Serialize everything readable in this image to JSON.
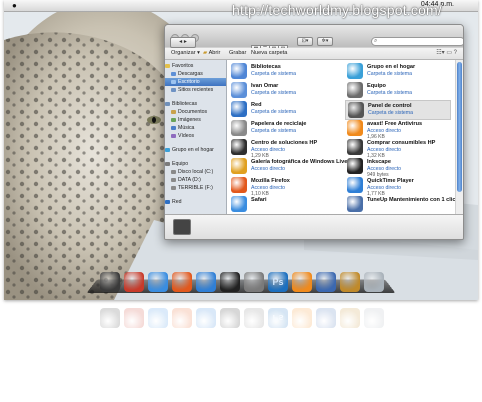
{
  "watermark": "http://techworldmy.blogspot.com/",
  "menubar": {
    "clock": "04:44 p.m."
  },
  "window": {
    "nav_label": "◂ ▸",
    "toolbar_view_buttons": [
      "▦",
      "☰",
      "▥",
      "▤"
    ],
    "toolbar_action_label": "✲▾",
    "toolbar_share_label": "⊡▾",
    "search_placeholder": "",
    "command_bar": {
      "organize": "Organizar ▾",
      "open": "Abrir",
      "burn": "Grabar",
      "new_folder": "Nueva carpeta",
      "view_icons": "☷▾ ▭ ?"
    },
    "sidebar": {
      "favorites_header": "Favoritos",
      "favorites": [
        "Descargas",
        "Escritorio",
        "Sitios recientes"
      ],
      "libraries_header": "Bibliotecas",
      "libraries": [
        "Documentos",
        "Imágenes",
        "Música",
        "Vídeos"
      ],
      "homegroup": "Grupo en el hogar",
      "computer_header": "Equipo",
      "drives": [
        "Disco local (C:)",
        "DATA (D:)",
        "TERRIBLE (F:)"
      ],
      "network": "Red"
    },
    "items": [
      {
        "name": "Bibliotecas",
        "sub": "Carpeta de sistema",
        "size": "",
        "icon": "libraries-folder-icon",
        "color": "#4f86d6"
      },
      {
        "name": "Grupo en el hogar",
        "sub": "Carpeta de sistema",
        "size": "",
        "icon": "homegroup-icon",
        "color": "#3aa0d8"
      },
      {
        "name": "Ivan Omar",
        "sub": "Carpeta de sistema",
        "size": "",
        "icon": "user-folder-icon",
        "color": "#5b8fd9"
      },
      {
        "name": "Equipo",
        "sub": "Carpeta de sistema",
        "size": "",
        "icon": "computer-icon",
        "color": "#6c6c6c"
      },
      {
        "name": "Red",
        "sub": "Carpeta de sistema",
        "size": "",
        "icon": "network-globe-icon",
        "color": "#2d6fc4"
      },
      {
        "name": "Panel de control",
        "sub": "Carpeta de sistema",
        "size": "",
        "icon": "control-panel-icon",
        "color": "#555555"
      },
      {
        "name": "Papelera de reciclaje",
        "sub": "Carpeta de sistema",
        "size": "",
        "icon": "recycle-bin-icon",
        "color": "#8a8a8a"
      },
      {
        "name": "avast! Free Antivirus",
        "sub": "Acceso directo",
        "size": "1,96 KB",
        "icon": "avast-icon",
        "color": "#f08a1c"
      },
      {
        "name": "Centro de soluciones HP",
        "sub": "Acceso directo",
        "size": "1,29 KB",
        "icon": "hp-solutions-icon",
        "color": "#2f2f2f"
      },
      {
        "name": "Comprar consumibles HP",
        "sub": "Acceso directo",
        "size": "1,32 KB",
        "icon": "hp-supplies-icon",
        "color": "#3a3a3a"
      },
      {
        "name": "Galería fotográfica de Windows Live",
        "sub": "Acceso directo",
        "size": "",
        "icon": "photo-gallery-icon",
        "color": "#e0a020"
      },
      {
        "name": "Inkscape",
        "sub": "Acceso directo",
        "size": "949 bytes",
        "icon": "inkscape-icon",
        "color": "#222222"
      },
      {
        "name": "Mozilla Firefox",
        "sub": "Acceso directo",
        "size": "1,10 KB",
        "icon": "firefox-icon",
        "color": "#e2581c"
      },
      {
        "name": "QuickTime Player",
        "sub": "Acceso directo",
        "size": "1,77 KB",
        "icon": "quicktime-icon",
        "color": "#2f7fd6"
      },
      {
        "name": "Safari",
        "sub": "",
        "size": "",
        "icon": "safari-icon",
        "color": "#3a8de0"
      },
      {
        "name": "TuneUp Mantenimiento con 1 clic",
        "sub": "",
        "size": "",
        "icon": "tuneup-icon",
        "color": "#4a6fa8"
      }
    ]
  },
  "dock": {
    "icons": [
      {
        "name": "toolbox-icon",
        "color": "#3a3a3a"
      },
      {
        "name": "adobe-app-icon",
        "color": "#c83a2a"
      },
      {
        "name": "safari-dock-icon",
        "color": "#3a8de0"
      },
      {
        "name": "firefox-dock-icon",
        "color": "#e2581c"
      },
      {
        "name": "quicktime-dock-icon",
        "color": "#2f7fd6"
      },
      {
        "name": "inkscape-dock-icon",
        "color": "#222222"
      },
      {
        "name": "system-prefs-dock-icon",
        "color": "#7a7a7a"
      },
      {
        "name": "photoshop-dock-icon",
        "color": "#1c6fbf"
      },
      {
        "name": "avast-dock-icon",
        "color": "#f08a1c"
      },
      {
        "name": "tuneup-dock-icon",
        "color": "#3b68b0"
      },
      {
        "name": "tools-dock-icon",
        "color": "#c08a2a"
      },
      {
        "name": "trash-dock-icon",
        "color": "#a9b2ba"
      }
    ],
    "photoshop_label": "Ps"
  }
}
